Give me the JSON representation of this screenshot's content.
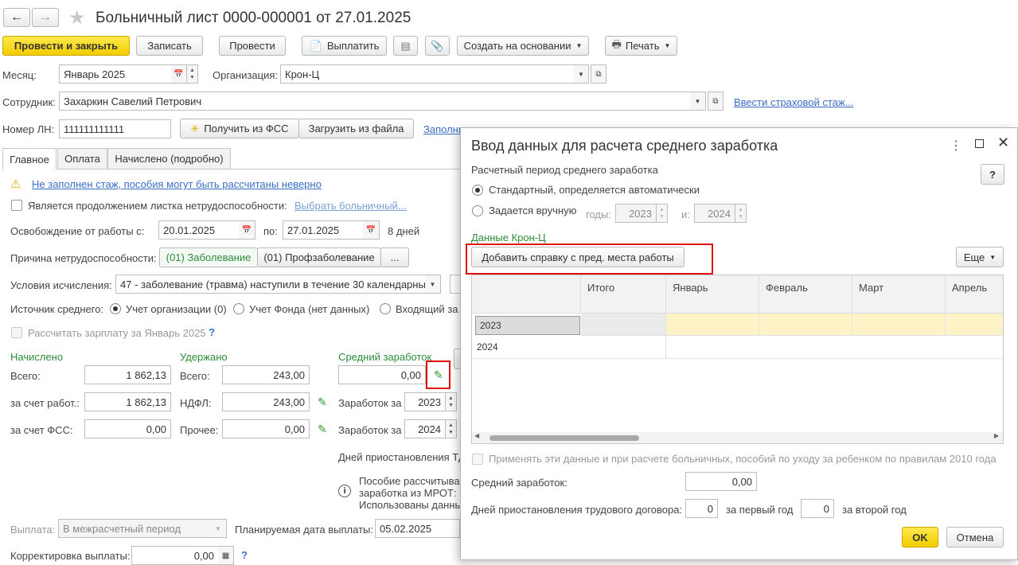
{
  "title": "Больничный лист 0000-000001 от 27.01.2025",
  "toolbar": {
    "post_close": "Провести и закрыть",
    "save": "Записать",
    "post": "Провести",
    "pay": "Выплатить",
    "create_based": "Создать на основании",
    "print": "Печать"
  },
  "form": {
    "month_label": "Месяц:",
    "month_value": "Январь 2025",
    "org_label": "Организация:",
    "org_value": "Крон-Ц",
    "employee_label": "Сотрудник:",
    "employee_value": "Захаркин Савелий Петрович",
    "insurance_link": "Ввести страховой стаж...",
    "ln_label": "Номер ЛН:",
    "ln_value": "111111111111",
    "get_fss": "Получить из ФСС",
    "load_file": "Загрузить из файла",
    "fill_link": "Заполни"
  },
  "tabs": [
    "Главное",
    "Оплата",
    "Начислено (подробно)"
  ],
  "main": {
    "warning_link": "Не заполнен стаж, пособия могут быть рассчитаны неверно",
    "continuation_label": "Является продолжением листка нетрудоспособности:",
    "continuation_link": "Выбрать больничный...",
    "release_label": "Освобождение от работы с:",
    "release_from": "20.01.2025",
    "release_to_label": "по:",
    "release_to": "27.01.2025",
    "days": "8 дней",
    "reason_label": "Причина нетрудоспособности:",
    "reason_1": "(01) Заболевание",
    "reason_2": "(01) Профзаболевание",
    "reason_more": "...",
    "conditions_label": "Условия исчисления:",
    "conditions_value": "47 - заболевание (травма) наступили в течение 30 календарных",
    "source_label": "Источник среднего:",
    "source_opt1": "Учет организации (0)",
    "source_opt2": "Учет Фонда (нет данных)",
    "source_opt3": "Входящий за",
    "calc_salary": "Рассчитать зарплату за Январь 2025",
    "help_q": "?",
    "accrued_header": "Начислено",
    "withheld_header": "Удержано",
    "avg_header": "Средний заработок",
    "total_label": "Всего:",
    "accrued_total": "1 862,13",
    "withheld_total": "243,00",
    "avg_value": "0,00",
    "employer_label": "за счет работ.:",
    "employer_value": "1 862,13",
    "ndfl_label": "НДФЛ:",
    "ndfl_value": "243,00",
    "earn_for_label": "Заработок за",
    "year1": "2023",
    "fss_label": "за счет ФСС:",
    "fss_value": "0,00",
    "other_label": "Прочее:",
    "other_value": "0,00",
    "year2": "2024",
    "suspension_label": "Дней приостановления ТД",
    "info_line1": "Пособие рассчитыва",
    "info_line2": "заработка из МРОТ: (",
    "info_line3": "Использованы данны",
    "payout_label": "Выплата:",
    "payout_value": "В межрасчетный период",
    "planned_label": "Планируемая дата выплаты:",
    "planned_value": "05.02.2025",
    "correction_label": "Корректировка выплаты:",
    "correction_value": "0,00"
  },
  "dialog": {
    "title": "Ввод данных для расчета среднего заработка",
    "help": "?",
    "period_label": "Расчетный период среднего заработка",
    "opt_standard": "Стандартный, определяется автоматически",
    "opt_manual": "Задается вручную",
    "years_label": "годы:",
    "year_a": "2023",
    "and_label": "и:",
    "year_b": "2024",
    "data_label": "Данные Крон-Ц",
    "add_button": "Добавить справку с пред. места работы",
    "more_button": "Еще",
    "columns": [
      "Итого",
      "Январь",
      "Февраль",
      "Март",
      "Апрель"
    ],
    "rows": [
      "2023",
      "2024"
    ],
    "apply_label": "Применять эти данные и при расчете больничных, пособий по уходу за ребенком по правилам 2010 года",
    "avg_label": "Средний заработок:",
    "avg_value": "0,00",
    "susp_label": "Дней приостановления трудового договора:",
    "susp_first": "0",
    "first_year_label": "за первый год",
    "susp_second": "0",
    "second_year_label": "за второй год",
    "ok": "OK",
    "cancel": "Отмена"
  },
  "colors": {
    "accent_yellow": "#f5d400",
    "green": "#2e8b3a",
    "link": "#3a6fc4",
    "highlight": "#e01010",
    "row_highlight": "#fdf3c6"
  }
}
